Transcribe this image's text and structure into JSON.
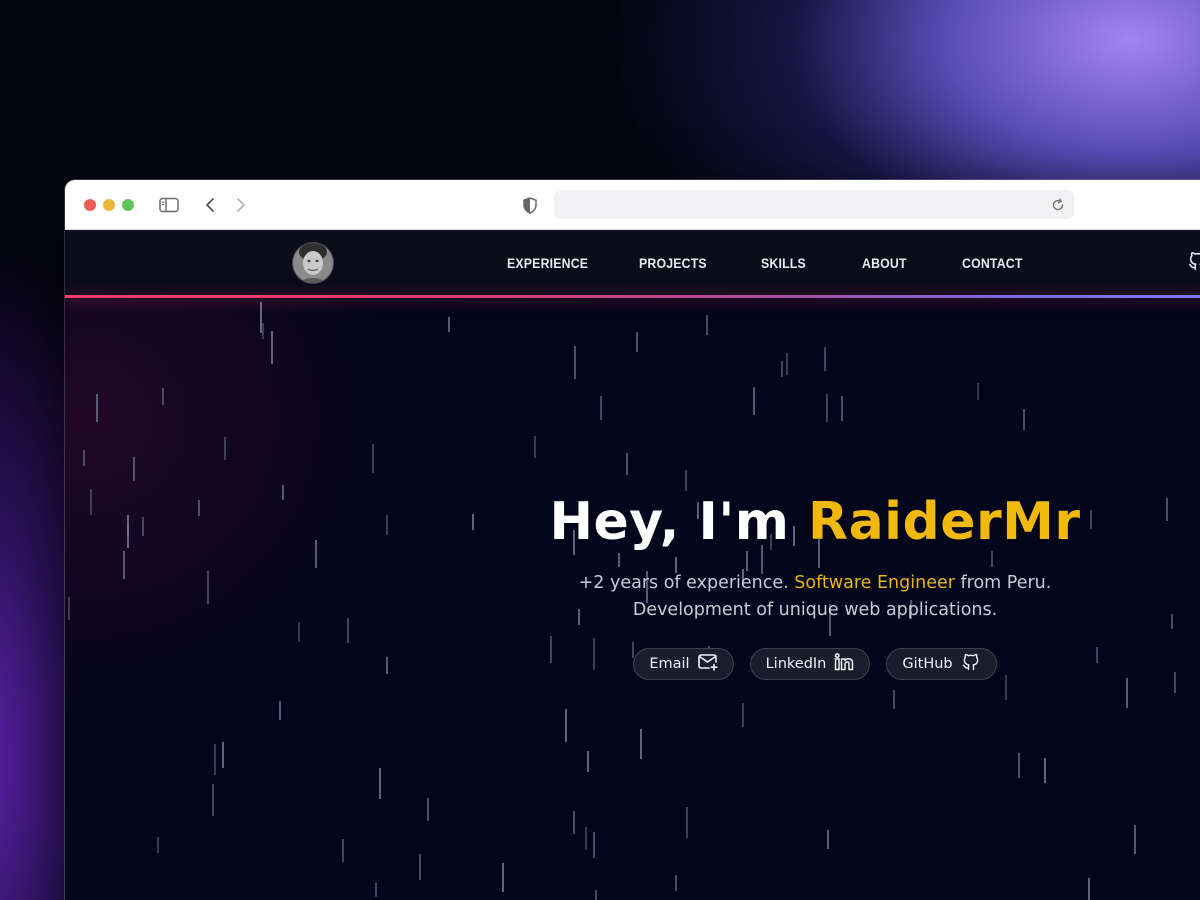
{
  "browser": {
    "url": "",
    "traffic_lights": [
      "#ec5f57",
      "#e9b53c",
      "#5fc45a"
    ]
  },
  "site": {
    "nav": {
      "items": [
        {
          "label": "EXPERIENCE"
        },
        {
          "label": "PROJECTS"
        },
        {
          "label": "SKILLS"
        },
        {
          "label": "ABOUT"
        },
        {
          "label": "CONTACT"
        }
      ]
    },
    "hero": {
      "title_prefix": "Hey, I'm ",
      "title_name": "RaiderMr",
      "text_before": "+2 years of experience. ",
      "text_highlight": "Software Engineer",
      "text_after": " from Peru.",
      "text_line2": "Development of unique web applications.",
      "buttons": [
        {
          "label": "Email",
          "icon": "mail-icon"
        },
        {
          "label": "LinkedIn",
          "icon": "linkedin-icon"
        },
        {
          "label": "GitHub",
          "icon": "github-icon"
        }
      ]
    },
    "colors": {
      "accent": "#f0b90b",
      "background": "#03051a",
      "glow_start": "#ff3d6e",
      "glow_end": "#7c7cff"
    }
  }
}
